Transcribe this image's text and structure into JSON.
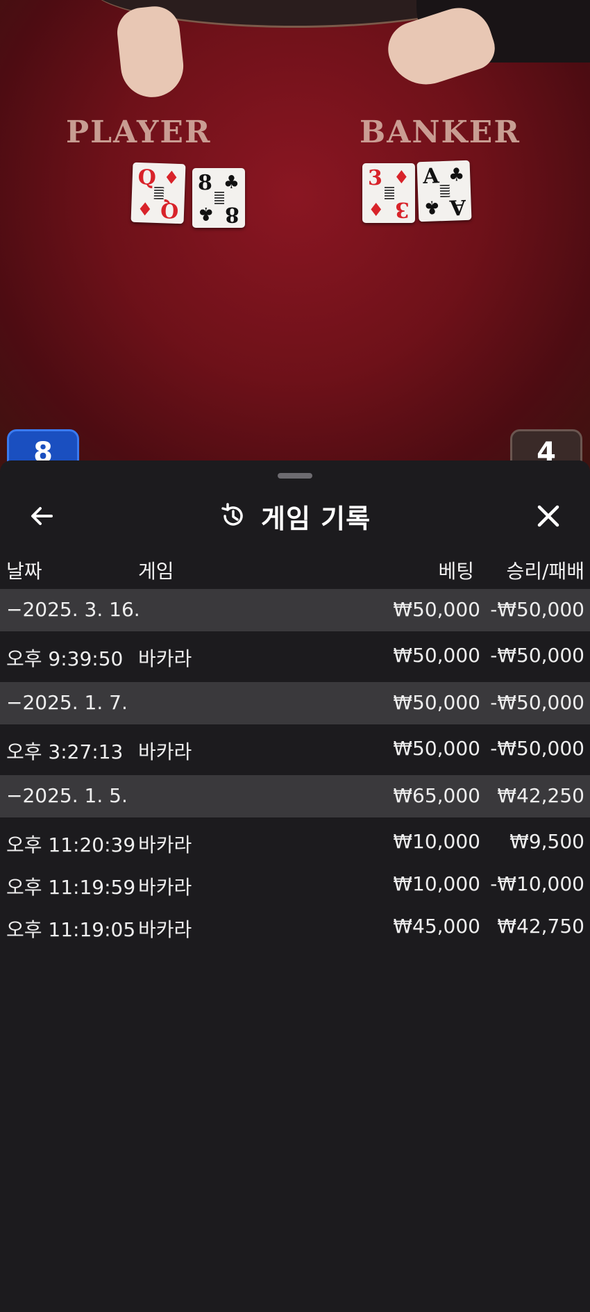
{
  "table": {
    "player_label": "PLAYER",
    "banker_label": "BANKER",
    "player_cards": [
      {
        "rank": "Q",
        "suit": "♦",
        "color": "red"
      },
      {
        "rank": "8",
        "suit": "♣",
        "color": "black"
      }
    ],
    "banker_cards": [
      {
        "rank": "3",
        "suit": "♦",
        "color": "red"
      },
      {
        "rank": "A",
        "suit": "♣",
        "color": "black"
      }
    ],
    "player_score": "8",
    "banker_score": "4"
  },
  "sheet": {
    "title": "게임 기록",
    "icons": {
      "back": "arrow-left-icon",
      "history": "history-icon",
      "close": "close-icon"
    },
    "columns": {
      "date": "날짜",
      "game": "게임",
      "bet": "베팅",
      "result": "승리/패배"
    },
    "rows": [
      {
        "type": "date",
        "date": "−2025. 3. 16.",
        "game": "",
        "bet": "₩50,000",
        "result": "-₩50,000"
      },
      {
        "type": "item",
        "date": "오후 9:39:50",
        "game": "바카라",
        "bet": "₩50,000",
        "result": "-₩50,000"
      },
      {
        "type": "date",
        "date": "−2025. 1. 7.",
        "game": "",
        "bet": "₩50,000",
        "result": "-₩50,000"
      },
      {
        "type": "item",
        "date": "오후 3:27:13",
        "game": "바카라",
        "bet": "₩50,000",
        "result": "-₩50,000"
      },
      {
        "type": "date",
        "date": "−2025. 1. 5.",
        "game": "",
        "bet": "₩65,000",
        "result": "₩42,250"
      },
      {
        "type": "item",
        "date": "오후 11:20:39",
        "game": "바카라",
        "bet": "₩10,000",
        "result": "₩9,500"
      },
      {
        "type": "item",
        "date": "오후 11:19:59",
        "game": "바카라",
        "bet": "₩10,000",
        "result": "-₩10,000"
      },
      {
        "type": "item",
        "date": "오후 11:19:05",
        "game": "바카라",
        "bet": "₩45,000",
        "result": "₩42,750"
      }
    ]
  },
  "colors": {
    "table_red": "#7a121c",
    "sheet_bg": "#1c1b1e",
    "date_row_bg": "#3a393c",
    "player_blue": "#1a4fc0"
  }
}
